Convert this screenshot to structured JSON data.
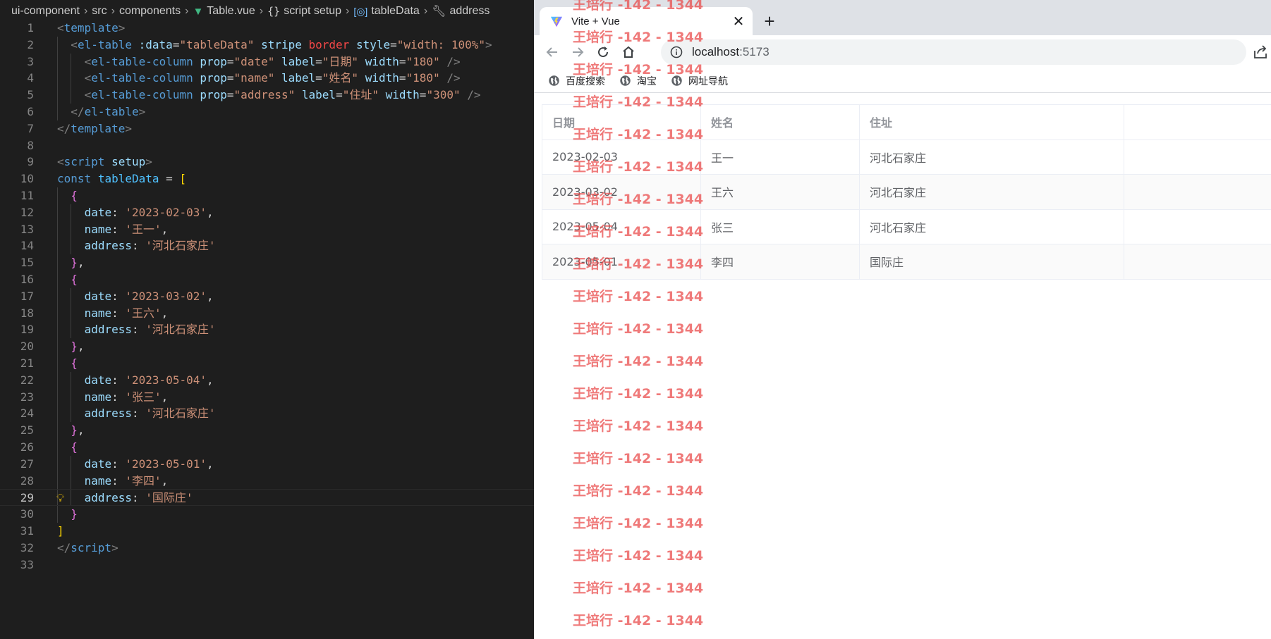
{
  "editor": {
    "breadcrumb": {
      "items": [
        "ui-component",
        "src",
        "components",
        "Table.vue",
        "script setup",
        "tableData",
        "address"
      ],
      "icons": [
        "vue-icon",
        "braces-icon",
        "variable-icon",
        "wrench-icon"
      ]
    },
    "current_line": 29,
    "lines": [
      {
        "n": "1",
        "indent": 0,
        "tokens": [
          [
            "punc",
            "<"
          ],
          [
            "tag",
            "template"
          ],
          [
            "punc",
            ">"
          ]
        ]
      },
      {
        "n": "2",
        "indent": 1,
        "tokens": [
          [
            "punc",
            "<"
          ],
          [
            "tag",
            "el-table"
          ],
          [
            "op",
            " "
          ],
          [
            "attr",
            ":data"
          ],
          [
            "op",
            "="
          ],
          [
            "str",
            "\"tableData\""
          ],
          [
            "op",
            " "
          ],
          [
            "attr",
            "stripe"
          ],
          [
            "op",
            " "
          ],
          [
            "red",
            "border"
          ],
          [
            "op",
            " "
          ],
          [
            "attr",
            "style"
          ],
          [
            "op",
            "="
          ],
          [
            "str",
            "\"width: 100%\""
          ],
          [
            "punc",
            ">"
          ]
        ]
      },
      {
        "n": "3",
        "indent": 2,
        "tokens": [
          [
            "punc",
            "<"
          ],
          [
            "tag",
            "el-table-column"
          ],
          [
            "op",
            " "
          ],
          [
            "attr",
            "prop"
          ],
          [
            "op",
            "="
          ],
          [
            "str",
            "\"date\""
          ],
          [
            "op",
            " "
          ],
          [
            "attr",
            "label"
          ],
          [
            "op",
            "="
          ],
          [
            "str",
            "\"日期\""
          ],
          [
            "op",
            " "
          ],
          [
            "attr",
            "width"
          ],
          [
            "op",
            "="
          ],
          [
            "str",
            "\"180\""
          ],
          [
            "op",
            " "
          ],
          [
            "punc",
            "/>"
          ]
        ]
      },
      {
        "n": "4",
        "indent": 2,
        "tokens": [
          [
            "punc",
            "<"
          ],
          [
            "tag",
            "el-table-column"
          ],
          [
            "op",
            " "
          ],
          [
            "attr",
            "prop"
          ],
          [
            "op",
            "="
          ],
          [
            "str",
            "\"name\""
          ],
          [
            "op",
            " "
          ],
          [
            "attr",
            "label"
          ],
          [
            "op",
            "="
          ],
          [
            "str",
            "\"姓名\""
          ],
          [
            "op",
            " "
          ],
          [
            "attr",
            "width"
          ],
          [
            "op",
            "="
          ],
          [
            "str",
            "\"180\""
          ],
          [
            "op",
            " "
          ],
          [
            "punc",
            "/>"
          ]
        ]
      },
      {
        "n": "5",
        "indent": 2,
        "tokens": [
          [
            "punc",
            "<"
          ],
          [
            "tag",
            "el-table-column"
          ],
          [
            "op",
            " "
          ],
          [
            "attr",
            "prop"
          ],
          [
            "op",
            "="
          ],
          [
            "str",
            "\"address\""
          ],
          [
            "op",
            " "
          ],
          [
            "attr",
            "label"
          ],
          [
            "op",
            "="
          ],
          [
            "str",
            "\"住址\""
          ],
          [
            "op",
            " "
          ],
          [
            "attr",
            "width"
          ],
          [
            "op",
            "="
          ],
          [
            "str",
            "\"300\""
          ],
          [
            "op",
            " "
          ],
          [
            "punc",
            "/>"
          ]
        ]
      },
      {
        "n": "6",
        "indent": 1,
        "tokens": [
          [
            "punc",
            "</"
          ],
          [
            "tag",
            "el-table"
          ],
          [
            "punc",
            ">"
          ]
        ]
      },
      {
        "n": "7",
        "indent": 0,
        "tokens": [
          [
            "punc",
            "</"
          ],
          [
            "tag",
            "template"
          ],
          [
            "punc",
            ">"
          ]
        ]
      },
      {
        "n": "8",
        "indent": 0,
        "tokens": []
      },
      {
        "n": "9",
        "indent": 0,
        "tokens": [
          [
            "punc",
            "<"
          ],
          [
            "tag",
            "script"
          ],
          [
            "op",
            " "
          ],
          [
            "attr",
            "setup"
          ],
          [
            "punc",
            ">"
          ]
        ]
      },
      {
        "n": "10",
        "indent": 0,
        "tokens": [
          [
            "kw",
            "const"
          ],
          [
            "op",
            " "
          ],
          [
            "var",
            "tableData"
          ],
          [
            "op",
            " = "
          ],
          [
            "br1",
            "["
          ]
        ]
      },
      {
        "n": "11",
        "indent": 1,
        "tokens": [
          [
            "br2",
            "{"
          ]
        ]
      },
      {
        "n": "12",
        "indent": 2,
        "tokens": [
          [
            "prop",
            "date"
          ],
          [
            "op",
            ": "
          ],
          [
            "str",
            "'2023-02-03'"
          ],
          [
            "op",
            ","
          ]
        ]
      },
      {
        "n": "13",
        "indent": 2,
        "tokens": [
          [
            "prop",
            "name"
          ],
          [
            "op",
            ": "
          ],
          [
            "str",
            "'王一'"
          ],
          [
            "op",
            ","
          ]
        ]
      },
      {
        "n": "14",
        "indent": 2,
        "tokens": [
          [
            "prop",
            "address"
          ],
          [
            "op",
            ": "
          ],
          [
            "str",
            "'河北石家庄'"
          ]
        ]
      },
      {
        "n": "15",
        "indent": 1,
        "tokens": [
          [
            "br2",
            "}"
          ],
          [
            "op",
            ","
          ]
        ]
      },
      {
        "n": "16",
        "indent": 1,
        "tokens": [
          [
            "br2",
            "{"
          ]
        ]
      },
      {
        "n": "17",
        "indent": 2,
        "tokens": [
          [
            "prop",
            "date"
          ],
          [
            "op",
            ": "
          ],
          [
            "str",
            "'2023-03-02'"
          ],
          [
            "op",
            ","
          ]
        ]
      },
      {
        "n": "18",
        "indent": 2,
        "tokens": [
          [
            "prop",
            "name"
          ],
          [
            "op",
            ": "
          ],
          [
            "str",
            "'王六'"
          ],
          [
            "op",
            ","
          ]
        ]
      },
      {
        "n": "19",
        "indent": 2,
        "tokens": [
          [
            "prop",
            "address"
          ],
          [
            "op",
            ": "
          ],
          [
            "str",
            "'河北石家庄'"
          ]
        ]
      },
      {
        "n": "20",
        "indent": 1,
        "tokens": [
          [
            "br2",
            "}"
          ],
          [
            "op",
            ","
          ]
        ]
      },
      {
        "n": "21",
        "indent": 1,
        "tokens": [
          [
            "br2",
            "{"
          ]
        ]
      },
      {
        "n": "22",
        "indent": 2,
        "tokens": [
          [
            "prop",
            "date"
          ],
          [
            "op",
            ": "
          ],
          [
            "str",
            "'2023-05-04'"
          ],
          [
            "op",
            ","
          ]
        ]
      },
      {
        "n": "23",
        "indent": 2,
        "tokens": [
          [
            "prop",
            "name"
          ],
          [
            "op",
            ": "
          ],
          [
            "str",
            "'张三'"
          ],
          [
            "op",
            ","
          ]
        ]
      },
      {
        "n": "24",
        "indent": 2,
        "tokens": [
          [
            "prop",
            "address"
          ],
          [
            "op",
            ": "
          ],
          [
            "str",
            "'河北石家庄'"
          ]
        ]
      },
      {
        "n": "25",
        "indent": 1,
        "tokens": [
          [
            "br2",
            "}"
          ],
          [
            "op",
            ","
          ]
        ]
      },
      {
        "n": "26",
        "indent": 1,
        "tokens": [
          [
            "br2",
            "{"
          ]
        ]
      },
      {
        "n": "27",
        "indent": 2,
        "tokens": [
          [
            "prop",
            "date"
          ],
          [
            "op",
            ": "
          ],
          [
            "str",
            "'2023-05-01'"
          ],
          [
            "op",
            ","
          ]
        ]
      },
      {
        "n": "28",
        "indent": 2,
        "tokens": [
          [
            "prop",
            "name"
          ],
          [
            "op",
            ": "
          ],
          [
            "str",
            "'李四'"
          ],
          [
            "op",
            ","
          ]
        ]
      },
      {
        "n": "29",
        "indent": 2,
        "tokens": [
          [
            "prop",
            "address"
          ],
          [
            "op",
            ": "
          ],
          [
            "str",
            "'国际庄'"
          ]
        ]
      },
      {
        "n": "30",
        "indent": 1,
        "tokens": [
          [
            "br2",
            "}"
          ]
        ]
      },
      {
        "n": "31",
        "indent": 0,
        "tokens": [
          [
            "br1",
            "]"
          ]
        ]
      },
      {
        "n": "32",
        "indent": 0,
        "tokens": [
          [
            "punc",
            "</"
          ],
          [
            "tag",
            "script"
          ],
          [
            "punc",
            ">"
          ]
        ]
      },
      {
        "n": "33",
        "indent": 0,
        "tokens": []
      }
    ]
  },
  "browser": {
    "tab": {
      "title": "Vite + Vue",
      "icon": "vite-icon"
    },
    "url": {
      "host": "localhost",
      "port": ":5173"
    },
    "bookmarks": [
      "百度搜索",
      "淘宝",
      "网址导航"
    ],
    "table": {
      "headers": [
        "日期",
        "姓名",
        "住址"
      ],
      "rows": [
        [
          "2023-02-03",
          "王一",
          "河北石家庄"
        ],
        [
          "2023-03-02",
          "王六",
          "河北石家庄"
        ],
        [
          "2023-05-04",
          "张三",
          "河北石家庄"
        ],
        [
          "2023-05-01",
          "李四",
          "国际庄"
        ]
      ]
    }
  },
  "watermark": {
    "text": "王培行 -142 - 1344",
    "count": 20
  },
  "colors": {
    "editor_bg": "#1e1e1e",
    "tag": "#569cd6",
    "attr": "#9cdcfe",
    "string": "#ce9178",
    "keyword_error": "#f44747",
    "bracket_gold": "#ffd700",
    "bracket_pink": "#da70d6",
    "table_header_text": "#909399",
    "table_text": "#606266",
    "watermark": "#e94646"
  }
}
